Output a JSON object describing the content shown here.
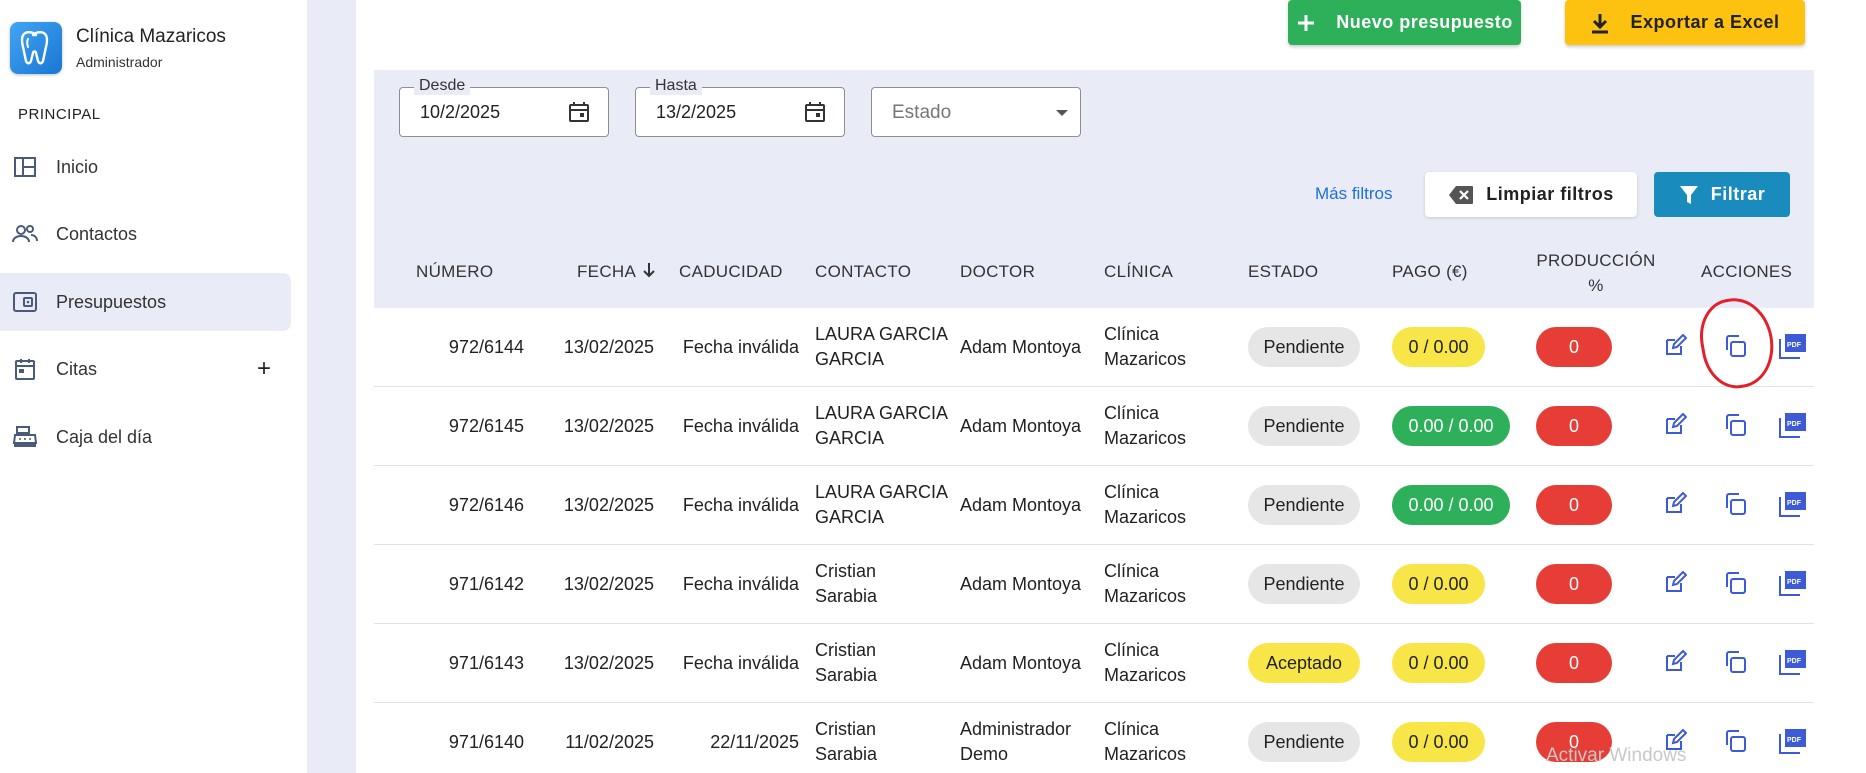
{
  "sidebar": {
    "brand_name": "Clínica Mazaricos",
    "brand_role": "Administrador",
    "section_title": "PRINCIPAL",
    "items": [
      {
        "label": "Inicio",
        "icon": "dashboard-icon"
      },
      {
        "label": "Contactos",
        "icon": "people-icon"
      },
      {
        "label": "Presupuestos",
        "icon": "wallet-icon",
        "active": true
      },
      {
        "label": "Citas",
        "icon": "calendar-icon",
        "expand": "+"
      },
      {
        "label": "Caja del día",
        "icon": "cash-register-icon"
      }
    ]
  },
  "toolbar": {
    "new_label": "Nuevo presupuesto",
    "export_label": "Exportar a Excel"
  },
  "filters": {
    "desde_label": "Desde",
    "desde_value": "10/2/2025",
    "hasta_label": "Hasta",
    "hasta_value": "13/2/2025",
    "estado_placeholder": "Estado",
    "more_filters": "Más filtros",
    "clear_label": "Limpiar filtros",
    "filter_label": "Filtrar"
  },
  "table": {
    "headers": {
      "numero": "NÚMERO",
      "fecha": "FECHA",
      "caducidad": "CADUCIDAD",
      "contacto": "CONTACTO",
      "doctor": "DOCTOR",
      "clinica": "CLÍNICA",
      "estado": "ESTADO",
      "pago": "PAGO (€)",
      "produccion_1": "PRODUCCIÓN",
      "produccion_2": "%",
      "acciones": "ACCIONES"
    },
    "rows": [
      {
        "numero": "972/6144",
        "fecha": "13/02/2025",
        "caducidad": "Fecha inválida",
        "contacto_1": "LAURA GARCIA",
        "contacto_2": "GARCIA",
        "doctor_1": "Adam Montoya",
        "doctor_2": "",
        "clinica_1": "Clínica",
        "clinica_2": "Mazaricos",
        "estado": "Pendiente",
        "pago": "0 / 0.00",
        "produccion": "0"
      },
      {
        "numero": "972/6145",
        "fecha": "13/02/2025",
        "caducidad": "Fecha inválida",
        "contacto_1": "LAURA GARCIA",
        "contacto_2": "GARCIA",
        "doctor_1": "Adam Montoya",
        "doctor_2": "",
        "clinica_1": "Clínica",
        "clinica_2": "Mazaricos",
        "estado": "Pendiente",
        "pago": "0.00 / 0.00",
        "produccion": "0"
      },
      {
        "numero": "972/6146",
        "fecha": "13/02/2025",
        "caducidad": "Fecha inválida",
        "contacto_1": "LAURA GARCIA",
        "contacto_2": "GARCIA",
        "doctor_1": "Adam Montoya",
        "doctor_2": "",
        "clinica_1": "Clínica",
        "clinica_2": "Mazaricos",
        "estado": "Pendiente",
        "pago": "0.00 / 0.00",
        "produccion": "0"
      },
      {
        "numero": "971/6142",
        "fecha": "13/02/2025",
        "caducidad": "Fecha inválida",
        "contacto_1": "Cristian",
        "contacto_2": "Sarabia",
        "doctor_1": "Adam Montoya",
        "doctor_2": "",
        "clinica_1": "Clínica",
        "clinica_2": "Mazaricos",
        "estado": "Pendiente",
        "pago": "0 / 0.00",
        "produccion": "0"
      },
      {
        "numero": "971/6143",
        "fecha": "13/02/2025",
        "caducidad": "Fecha inválida",
        "contacto_1": "Cristian",
        "contacto_2": "Sarabia",
        "doctor_1": "Adam Montoya",
        "doctor_2": "",
        "clinica_1": "Clínica",
        "clinica_2": "Mazaricos",
        "estado": "Aceptado",
        "pago": "0 / 0.00",
        "produccion": "0"
      },
      {
        "numero": "971/6140",
        "fecha": "11/02/2025",
        "caducidad": "22/11/2025",
        "contacto_1": "Cristian",
        "contacto_2": "Sarabia",
        "doctor_1": "Administrador",
        "doctor_2": "Demo",
        "clinica_1": "Clínica",
        "clinica_2": "Mazaricos",
        "estado": "Pendiente",
        "pago": "0 / 0.00",
        "produccion": "0"
      }
    ]
  },
  "watermark": "Activar Windows",
  "colors": {
    "green": "#2eb05a",
    "yellow": "#fdc20f",
    "blue": "#1a8bbd",
    "red": "#e63e36",
    "panel": "#e9ecf6",
    "annotation": "#e3202a"
  }
}
